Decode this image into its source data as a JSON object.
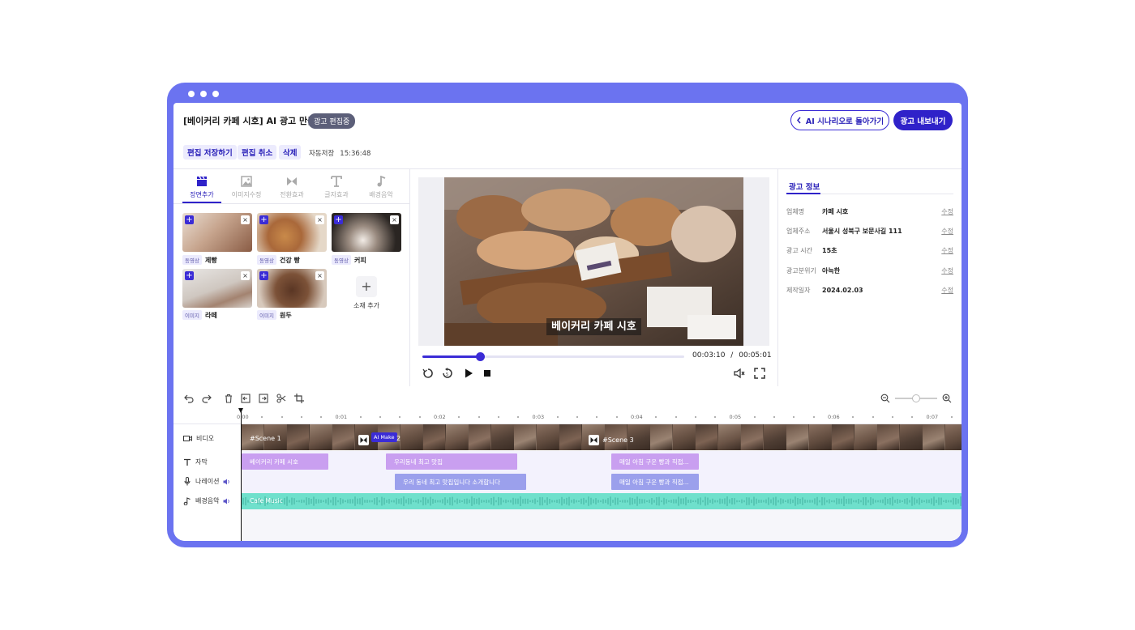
{
  "header": {
    "title": "[베이커리 카페 시호] AI 광고 만들기",
    "status_badge": "광고 편집중",
    "back_button": "AI 시나리오로 돌아가기",
    "export_button": "광고 내보내기"
  },
  "toolbar": {
    "save": "편집 저장하기",
    "cancel": "편집 취소",
    "delete": "삭제",
    "autosave_label": "자동저장",
    "autosave_time": "15:36:48"
  },
  "left_tabs": [
    {
      "label": "장면추가",
      "icon": "clapperboard-icon",
      "active": true
    },
    {
      "label": "이미지수정",
      "icon": "image-icon",
      "active": false
    },
    {
      "label": "전환효과",
      "icon": "transition-icon",
      "active": false
    },
    {
      "label": "글자효과",
      "icon": "text-icon",
      "active": false
    },
    {
      "label": "배경음악",
      "icon": "music-note-icon",
      "active": false
    }
  ],
  "materials": [
    {
      "type": "동영상",
      "name": "제빵"
    },
    {
      "type": "동영상",
      "name": "건강 빵"
    },
    {
      "type": "동영상",
      "name": "커피"
    },
    {
      "type": "이미지",
      "name": "라떼"
    },
    {
      "type": "이미지",
      "name": "원두"
    }
  ],
  "add_material": "소재 추가",
  "preview": {
    "caption": "베이커리 카페 시호",
    "current_time": "00:03:10",
    "separator": "/",
    "total_time": "00:05:01",
    "progress": 0.22
  },
  "info": {
    "tab": "광고 정보",
    "edit_label": "수정",
    "rows": [
      {
        "key": "업체명",
        "value": "카페 시호"
      },
      {
        "key": "업체주소",
        "value": "서울시 성북구 보문사길 111"
      },
      {
        "key": "광고 시간",
        "value": "15초"
      },
      {
        "key": "광고분위기",
        "value": "아늑한"
      },
      {
        "key": "제작일자",
        "value": "2024.02.03"
      }
    ]
  },
  "timeline": {
    "ruler": [
      "0:00",
      "0:01",
      "0:02",
      "0:03",
      "0:04",
      "0:05",
      "0:06",
      "0:07"
    ],
    "tracks": {
      "video": "비디오",
      "subtitle": "자막",
      "narration": "나레이션",
      "music": "배경음악"
    },
    "scenes": [
      "#Scene 1",
      "2",
      "#Scene 3"
    ],
    "ai_tag": "AI Make",
    "subtitle_clips": [
      "베이커리 카페 시호",
      "우리동네 최고 맛집",
      "매일 아침 구운 빵과 직접..."
    ],
    "narration_clips": [
      "우리 동네 최고 맛집입니다 소개합니다",
      "매일 아침 구운 빵과 직접..."
    ],
    "music_clip": "Cafe Music"
  },
  "colors": {
    "frame": "#6b73f0",
    "accent": "#2f22c9",
    "subtitle_clip": "#c99ff0",
    "narration_clip": "#9ba0ec",
    "music_clip": "#6fe0cc"
  }
}
